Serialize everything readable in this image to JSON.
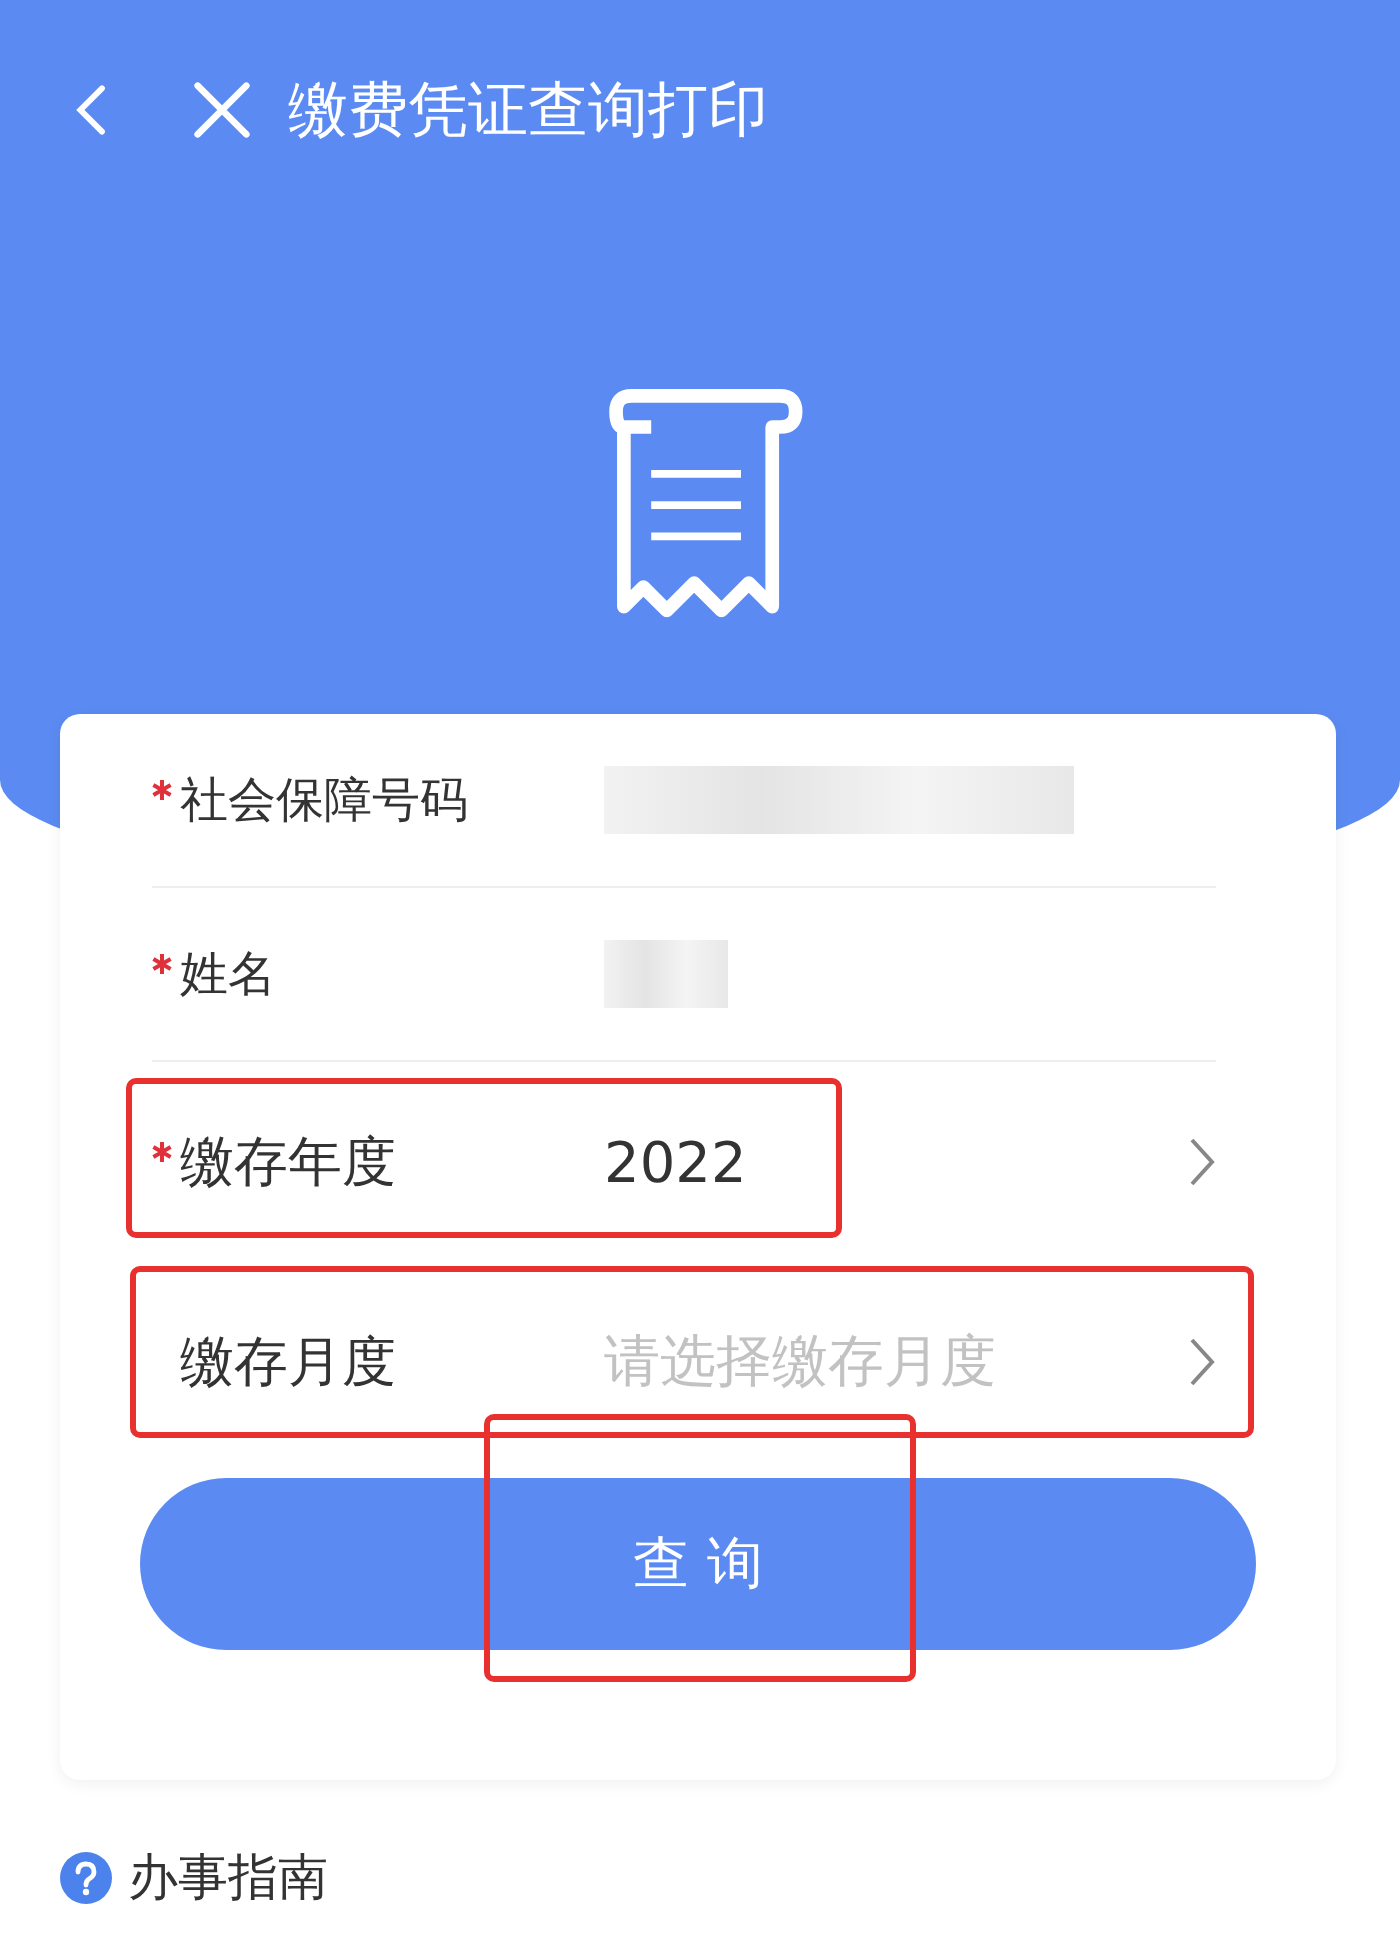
{
  "header": {
    "title": "缴费凭证查询打印"
  },
  "fields": [
    {
      "kind": "text",
      "label": "社会保障号码",
      "required": true,
      "redacted": true,
      "highlighted": false
    },
    {
      "kind": "text",
      "label": "姓名",
      "required": true,
      "redacted": true,
      "highlighted": false
    },
    {
      "kind": "select",
      "label": "缴存年度",
      "required": true,
      "value": "2022",
      "highlighted": true
    },
    {
      "kind": "select",
      "label": "缴存月度",
      "required": false,
      "placeholder": "请选择缴存月度",
      "highlighted": true
    }
  ],
  "query_button": {
    "label": "查 询",
    "highlighted": true
  },
  "guide_link": {
    "label": "办事指南"
  }
}
